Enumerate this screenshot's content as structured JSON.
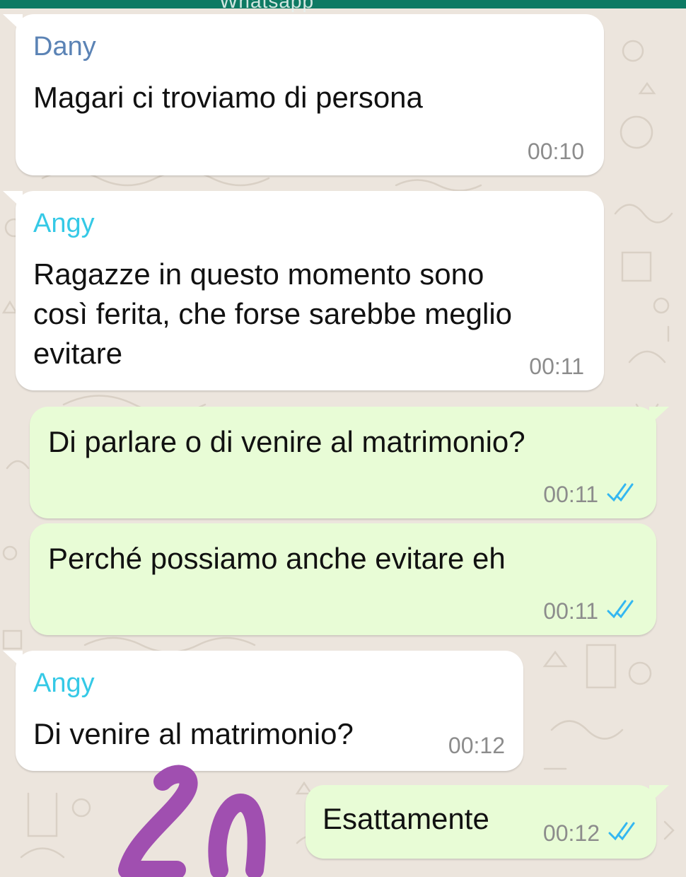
{
  "header": {
    "title": "Whatsapp"
  },
  "colors": {
    "header": "#0e7a63",
    "incoming_bubble": "#ffffff",
    "outgoing_bubble": "#e8fcd6",
    "sender_dany": "#5b83b5",
    "sender_angy": "#35c9e6",
    "read_ticks": "#34b7f1",
    "scribble": "#a04fb0"
  },
  "messages": [
    {
      "direction": "incoming",
      "sender": "Dany",
      "text": "Magari ci troviamo di persona",
      "time": "00:10"
    },
    {
      "direction": "incoming",
      "sender": "Angy",
      "text_lines": [
        "Ragazze in questo momento sono",
        "così ferita, che forse sarebbe meglio",
        "evitare"
      ],
      "time": "00:11"
    },
    {
      "direction": "outgoing",
      "text": "Di parlare o di venire al matrimonio?",
      "time": "00:11",
      "status_icon": "double-check-read-icon"
    },
    {
      "direction": "outgoing",
      "text": "Perché possiamo anche evitare eh",
      "time": "00:11",
      "status_icon": "double-check-read-icon"
    },
    {
      "direction": "incoming",
      "sender": "Angy",
      "text": "Di venire al matrimonio?",
      "time": "00:12"
    },
    {
      "direction": "outgoing",
      "text": "Esattamente",
      "time": "00:12",
      "status_icon": "double-check-read-icon"
    }
  ]
}
